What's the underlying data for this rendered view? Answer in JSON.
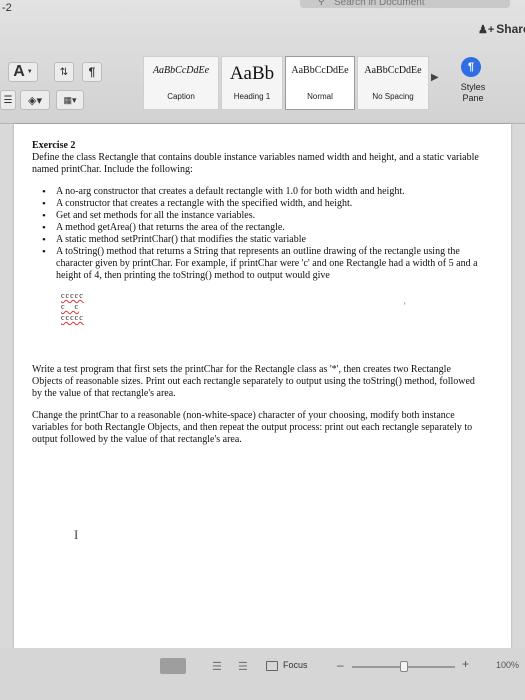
{
  "window": {
    "title_fragment": "-2",
    "search_placeholder": "Search in Document",
    "share_label": "Share"
  },
  "ribbon": {
    "styles": [
      {
        "sample": "AaBbCcDdEe",
        "name": "Caption"
      },
      {
        "sample": "AaBb",
        "name": "Heading 1"
      },
      {
        "sample": "AaBbCcDdEe",
        "name": "Normal"
      },
      {
        "sample": "AaBbCcDdEe",
        "name": "No Spacing"
      }
    ],
    "styles_pane_label": "Styles Pane",
    "icons": {
      "font_color": "font-color-icon",
      "sort": "sort-icon",
      "paragraph_marks": "pilcrow-icon",
      "styles_pane": "styles-pane-icon"
    }
  },
  "document": {
    "heading": "Exercise 2",
    "intro": "Define the class Rectangle that contains double instance variables named width and height, and a static variable named printChar. Include the following:",
    "requirements": [
      "A no-arg constructor that creates a default rectangle with 1.0 for both width and height.",
      "A constructor that creates a rectangle with the specified width, and height.",
      "Get and set methods for all the instance variables.",
      "A method getArea() that returns the area of the rectangle.",
      "A static method setPrintChar() that modifies the static variable",
      "A toString() method that returns a String that represents an outline drawing of the rectangle using the character given by printChar. For example, if printChar were 'c' and one Rectangle had a width of 5 and a height of 4, then printing the toString() method to output would give"
    ],
    "sample_output": [
      "ccccc",
      "c   c",
      "ccccc"
    ],
    "para_test": "Write a test program that first sets the printChar for the Rectangle class as '*', then creates two Rectangle Objects of reasonable sizes. Print out each rectangle separately to output using the toString() method, followed by the value of that rectangle's area.",
    "para_change": "Change the printChar to a reasonable (non-white-space) character of your choosing, modify both instance variables for both Rectangle Objects, and then repeat the output process: print out each rectangle separately to output followed by the value of that rectangle's area."
  },
  "status_bar": {
    "focus_label": "Focus",
    "zoom_level": "100%",
    "zoom_fraction": 0.5
  },
  "colors": {
    "accent": "#2f6ee3",
    "spellcheck": "#d33333"
  }
}
